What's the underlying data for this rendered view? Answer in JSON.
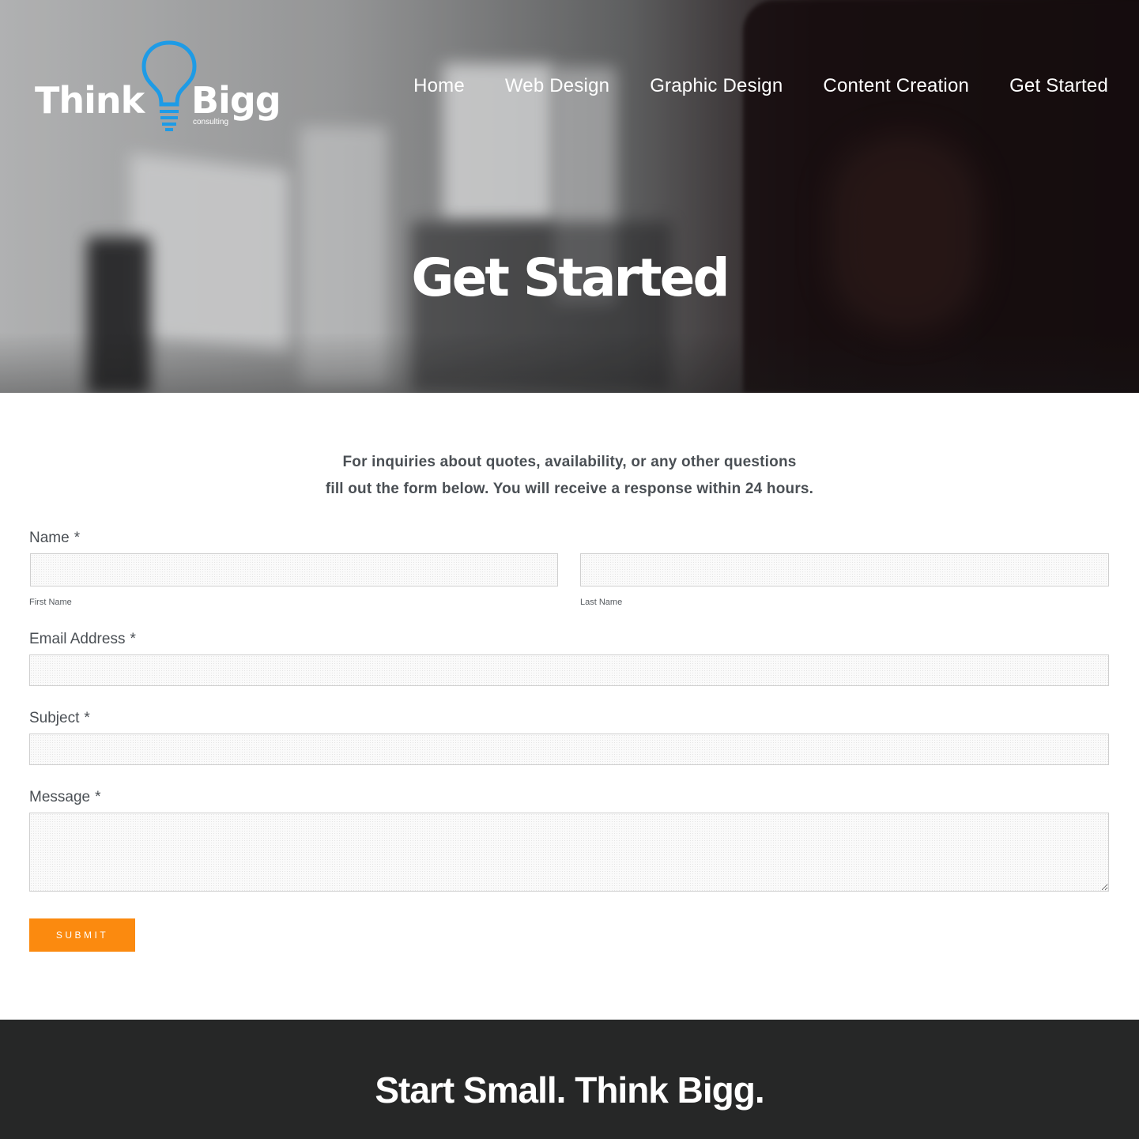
{
  "brand": {
    "name_left": "Think",
    "name_right": "Bigg",
    "tagline_small": "consulting",
    "accent_color": "#1e9be6"
  },
  "nav": {
    "items": [
      {
        "label": "Home"
      },
      {
        "label": "Web Design"
      },
      {
        "label": "Graphic Design"
      },
      {
        "label": "Content Creation"
      },
      {
        "label": "Get Started"
      }
    ]
  },
  "hero": {
    "title": "Get Started"
  },
  "intro": {
    "line1": "For inquiries about quotes, availability, or any other questions",
    "line2": "fill out the form below. You will receive a response within 24 hours."
  },
  "form": {
    "name": {
      "label": "Name",
      "required_mark": "*",
      "first_sublabel": "First Name",
      "last_sublabel": "Last Name",
      "first_value": "",
      "last_value": ""
    },
    "email": {
      "label": "Email Address",
      "required_mark": "*",
      "value": ""
    },
    "subject": {
      "label": "Subject",
      "required_mark": "*",
      "value": ""
    },
    "message": {
      "label": "Message",
      "required_mark": "*",
      "value": ""
    },
    "submit_label": "SUBMIT",
    "submit_color": "#fb8a0f"
  },
  "footer": {
    "tagline": "Start Small. Think Bigg.",
    "background_color": "#262727"
  }
}
